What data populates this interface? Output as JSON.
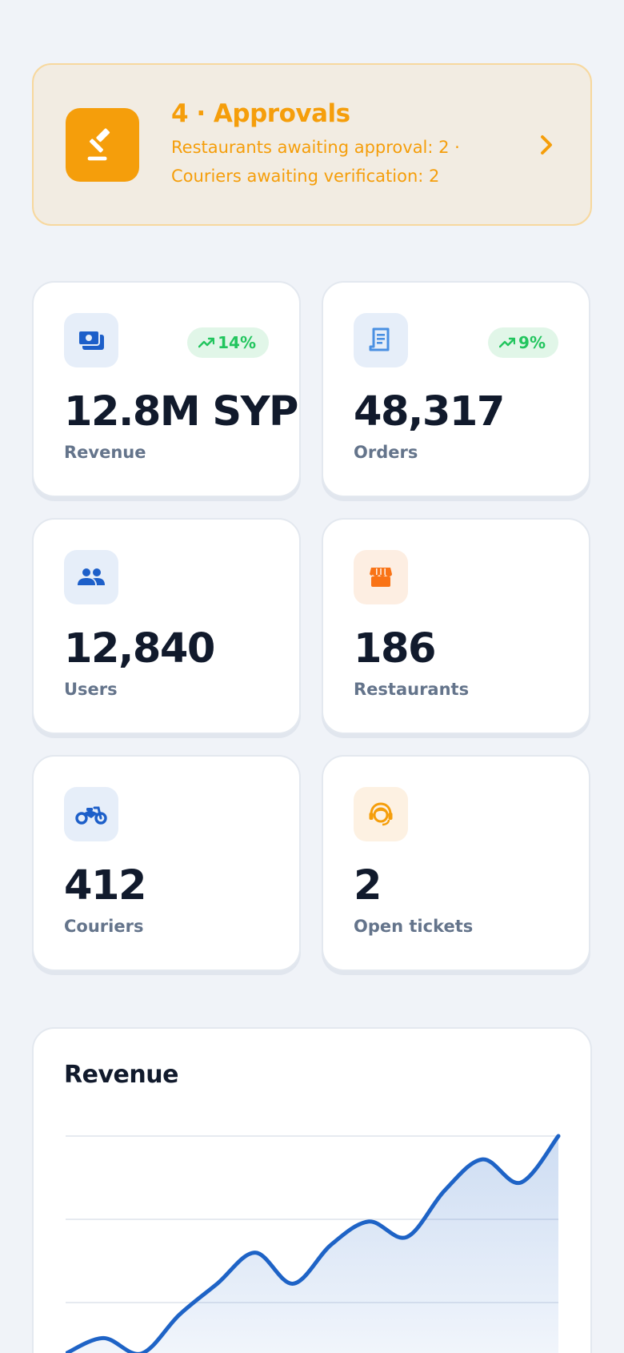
{
  "approvals": {
    "title": "4 · Approvals",
    "line1": "Restaurants awaiting approval: 2 ·",
    "line2": "Couriers awaiting verification: 2",
    "icon": "gavel-icon",
    "accent": "#f59e0b"
  },
  "stats": [
    {
      "value": "12.8M SYP",
      "label": "Revenue",
      "trend": "14%",
      "icon": "payments-icon",
      "icon_color": "#1d5fc9",
      "icon_bg": "#e6eef9"
    },
    {
      "value": "48,317",
      "label": "Orders",
      "trend": "9%",
      "icon": "receipt-icon",
      "icon_color": "#4a90e2",
      "icon_bg": "#e6eef9"
    },
    {
      "value": "12,840",
      "label": "Users",
      "icon": "group-icon",
      "icon_color": "#1d5fc9",
      "icon_bg": "#e6eef9"
    },
    {
      "value": "186",
      "label": "Restaurants",
      "icon": "storefront-icon",
      "icon_color": "#f97316",
      "icon_bg": "#fdeee2"
    },
    {
      "value": "412",
      "label": "Couriers",
      "icon": "motorcycle-icon",
      "icon_color": "#1d5fc9",
      "icon_bg": "#e6eef9"
    },
    {
      "value": "2",
      "label": "Open tickets",
      "icon": "support-agent-icon",
      "icon_color": "#f59e0b",
      "icon_bg": "#fdf1e2"
    }
  ],
  "trend_color": "#22c55e",
  "revenue_chart": {
    "title": "Revenue",
    "chart_data": {
      "type": "area",
      "title": "Revenue",
      "xlabel": "",
      "ylabel": "",
      "grid": true,
      "x": [
        1,
        2,
        3,
        4,
        5,
        6,
        7,
        8,
        9,
        10,
        11,
        12,
        13,
        14
      ],
      "values": [
        6,
        8,
        6,
        11,
        15,
        19,
        15,
        20,
        23,
        21,
        27,
        31,
        28,
        34
      ],
      "ylim": [
        0,
        34
      ],
      "color": "#1e63c6"
    }
  }
}
